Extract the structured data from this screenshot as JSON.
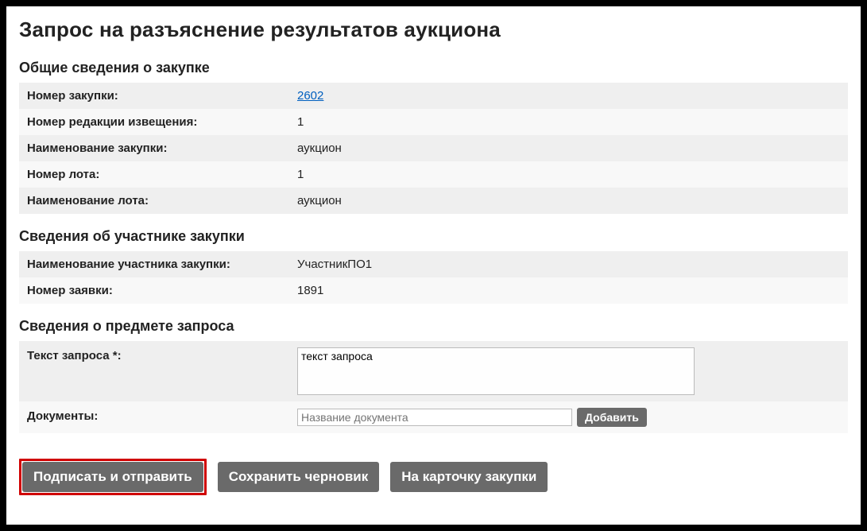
{
  "page_title": "Запрос на разъяснение результатов аукциона",
  "sections": {
    "general": {
      "heading": "Общие сведения о закупке",
      "rows": {
        "purchase_number_label": "Номер закупки:",
        "purchase_number_value": "2602",
        "notice_revision_label": "Номер редакции извещения:",
        "notice_revision_value": "1",
        "purchase_name_label": "Наименование закупки:",
        "purchase_name_value": "аукцион",
        "lot_number_label": "Номер лота:",
        "lot_number_value": "1",
        "lot_name_label": "Наименование лота:",
        "lot_name_value": "аукцион"
      }
    },
    "participant": {
      "heading": "Сведения об участнике закупки",
      "rows": {
        "participant_name_label": "Наименование участника закупки:",
        "participant_name_value": "УчастникПО1",
        "application_number_label": "Номер заявки:",
        "application_number_value": "1891"
      }
    },
    "request": {
      "heading": "Сведения о предмете запроса",
      "query_text_label": "Текст запроса *:",
      "query_text_value": "текст запроса",
      "documents_label": "Документы:",
      "doc_name_placeholder": "Название документа",
      "add_button": "Добавить"
    }
  },
  "actions": {
    "sign_and_send": "Подписать и отправить",
    "save_draft": "Сохранить черновик",
    "to_purchase_card": "На карточку закупки"
  }
}
